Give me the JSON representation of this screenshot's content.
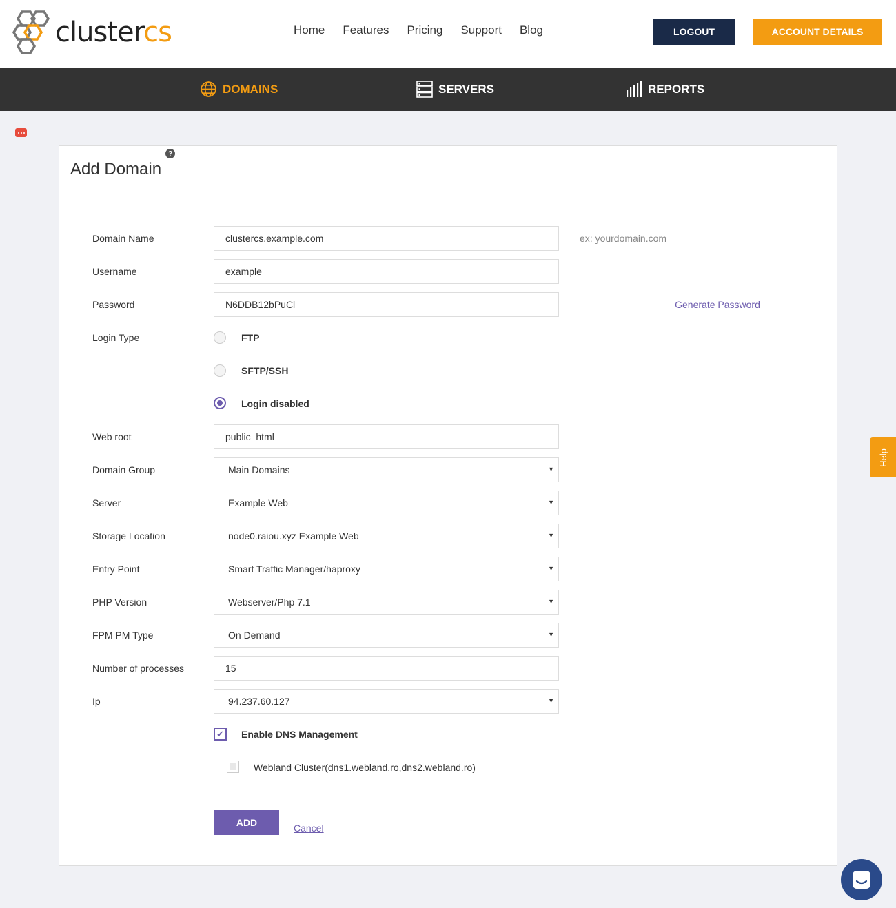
{
  "header": {
    "logo_prefix": "cluster",
    "logo_suffix": "cs",
    "nav": [
      "Home",
      "Features",
      "Pricing",
      "Support",
      "Blog"
    ],
    "logout_label": "LOGOUT",
    "account_label": "ACCOUNT DETAILS"
  },
  "mainnav": {
    "domains": "DOMAINS",
    "servers": "SERVERS",
    "reports": "REPORTS"
  },
  "page": {
    "title": "Add Domain",
    "help_symbol": "?"
  },
  "form": {
    "domain_name_label": "Domain Name",
    "domain_name_value": "clustercs.example.com",
    "domain_name_hint": "ex: yourdomain.com",
    "username_label": "Username",
    "username_value": "example",
    "password_label": "Password",
    "password_value": "N6DDB12bPuCl",
    "generate_password": "Generate Password",
    "login_type_label": "Login Type",
    "login_types": [
      "FTP",
      "SFTP/SSH",
      "Login disabled"
    ],
    "login_type_selected": "Login disabled",
    "web_root_label": "Web root",
    "web_root_value": "public_html",
    "domain_group_label": "Domain Group",
    "domain_group_value": "Main Domains",
    "server_label": "Server",
    "server_value": "Example Web",
    "storage_label": "Storage Location",
    "storage_value": "node0.raiou.xyz Example Web",
    "entry_point_label": "Entry Point",
    "entry_point_value": "Smart Traffic Manager/haproxy",
    "php_label": "PHP Version",
    "php_value": "Webserver/Php 7.1",
    "fpm_label": "FPM PM Type",
    "fpm_value": "On Demand",
    "processes_label": "Number of processes",
    "processes_value": "15",
    "ip_label": "Ip",
    "ip_value": "94.237.60.127",
    "dns_label": "Enable DNS Management",
    "dns_checked": true,
    "dns_cluster_label": "Webland Cluster(dns1.webland.ro,dns2.webland.ro)",
    "dns_cluster_checked": false,
    "add_label": "ADD",
    "cancel_label": "Cancel"
  },
  "side": {
    "help_tab": "Help"
  },
  "colors": {
    "accent": "#6d5cae",
    "brand_orange": "#f39c12",
    "navy": "#1a2a48",
    "darkbar": "#333333"
  }
}
